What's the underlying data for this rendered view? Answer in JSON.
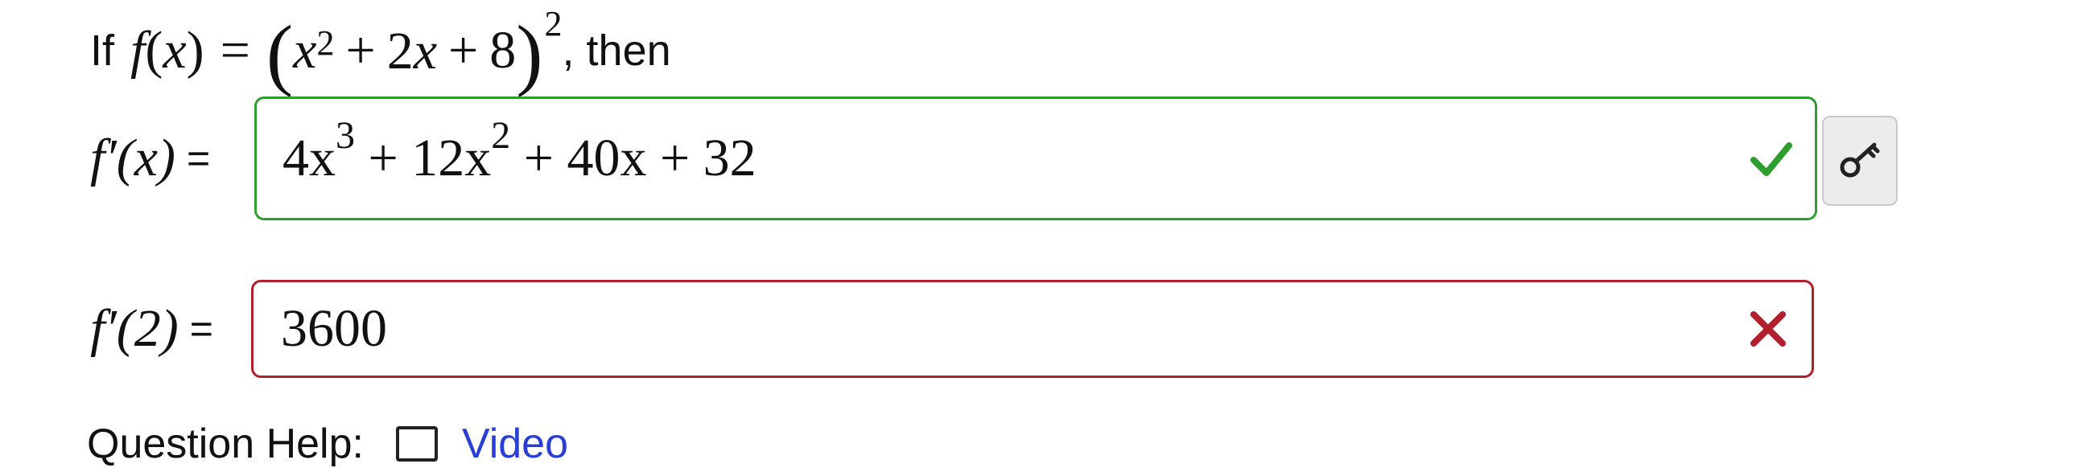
{
  "prompt": {
    "prefix": "If",
    "suffix": ", then",
    "function_name": "f",
    "variable": "x",
    "inner": {
      "term1_base": "x",
      "term1_exp": "2",
      "op1": "+",
      "term2": "2x",
      "op2": "+",
      "term3": "8"
    },
    "outer_exp": "2"
  },
  "question1": {
    "label": "f′(x)",
    "equals": "=",
    "answer": {
      "c1": "4x",
      "e1": "3",
      "op1": " + ",
      "c2": "12x",
      "e2": "2",
      "rest": " + 40x + 32"
    },
    "status": "correct",
    "status_color": "#2e9e2e"
  },
  "question2": {
    "label": "f′(2)",
    "equals": "=",
    "answer_value": "3600",
    "status": "incorrect",
    "status_color": "#b21f2d"
  },
  "key_button": {
    "icon": "key-icon"
  },
  "help": {
    "label": "Question Help:",
    "video_label": "Video",
    "video_icon": "video-icon"
  }
}
